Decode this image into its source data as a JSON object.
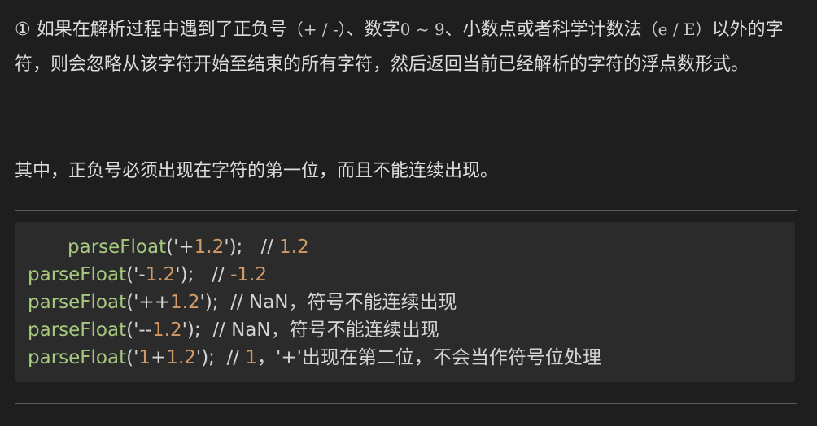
{
  "intro": {
    "bullet": "①",
    "segment1": "如果在解析过程中遇到了正负号",
    "signs": "（+ / -）",
    "segment2": "、数字",
    "digits": "0 ~ 9",
    "segment3": "、小数点或者科学计数法",
    "exp": "（e / E）",
    "segment4": "以外的字符，则会忽略从该字符开始至结束的所有字符，然后返回当前已经解析的字符的浮点数形式。"
  },
  "note": "其中，正负号必须出现在字符的第一位，而且不能连续出现。",
  "code_lines": [
    {
      "fn": "parseFloat",
      "open": "('",
      "sign": "+",
      "num": "1.2",
      "close": "');   ",
      "comment_prefix": "// ",
      "comment_num": "1.2",
      "comment_rest": ""
    },
    {
      "fn": "parseFloat",
      "open": "('",
      "sign": "-",
      "num": "1.2",
      "close": "');   ",
      "comment_prefix": "// ",
      "comment_num": "",
      "comment_rest": "-1.2"
    },
    {
      "fn": "parseFloat",
      "open": "('",
      "sign": "++",
      "num": "1.2",
      "close": "');  ",
      "comment_prefix": "// ",
      "comment_num": "",
      "comment_rest": "NaN，符号不能连续出现"
    },
    {
      "fn": "parseFloat",
      "open": "('",
      "sign": "--",
      "num": "1.2",
      "close": "');  ",
      "comment_prefix": "// ",
      "comment_num": "",
      "comment_rest": "NaN，符号不能连续出现"
    },
    {
      "fn": "parseFloat",
      "open": "('",
      "sign": "",
      "num": "1",
      "sign2": "+",
      "num2": "1.2",
      "close": "');  ",
      "comment_prefix": "// ",
      "comment_num": "1",
      "comment_rest": "，'+'出现在第二位，不会当作符号位处理"
    }
  ]
}
